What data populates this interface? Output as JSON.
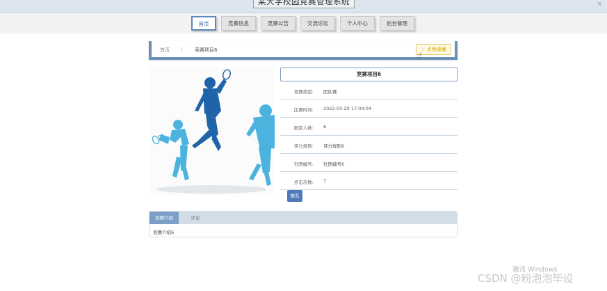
{
  "header": {
    "site_title": "某大学校园竞赛管理系统",
    "close_glyph": "×"
  },
  "nav": {
    "items": [
      {
        "label": "首页",
        "active": true
      },
      {
        "label": "竞赛信息",
        "active": false
      },
      {
        "label": "竞赛公告",
        "active": false
      },
      {
        "label": "交流论坛",
        "active": false
      },
      {
        "label": "个人中心",
        "active": false
      },
      {
        "label": "后台管理",
        "active": false
      }
    ]
  },
  "breadcrumb": {
    "home": "首页",
    "separator": "/",
    "current": "竞赛项目6"
  },
  "favorite_button": {
    "label": "☆ 点我收藏"
  },
  "detail": {
    "title": "竞赛项目6",
    "fields": [
      {
        "key": "竞赛类型:",
        "value": "团队赛"
      },
      {
        "key": "比赛时间:",
        "value": "2022-03-20 17:04:04"
      },
      {
        "key": "限定人数:",
        "value": "6"
      },
      {
        "key": "评分规则:",
        "value": "评分规则6"
      },
      {
        "key": "社团编号:",
        "value": "社团编号6"
      },
      {
        "key": "点击次数:",
        "value": "7"
      }
    ],
    "signup_label": "报名"
  },
  "tabs": {
    "items": [
      {
        "label": "竞赛介绍",
        "active": true
      },
      {
        "label": "评论",
        "active": false
      }
    ],
    "content": "竞赛介绍6"
  },
  "watermarks": {
    "windows": "激活 Windows",
    "csdn": "CSDN @粉泡泡毕设"
  },
  "colors": {
    "accent": "#5b88b9",
    "figure_dark": "#1f63a8",
    "figure_light": "#4cb3df"
  }
}
